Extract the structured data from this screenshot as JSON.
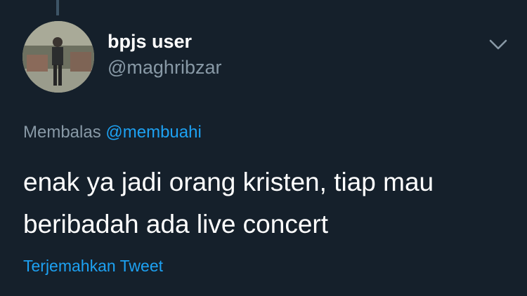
{
  "tweet": {
    "author": {
      "display_name": "bpjs user",
      "handle": "@maghribzar"
    },
    "reply_to": {
      "prefix": "Membalas",
      "mention": "@membuahi"
    },
    "text": "enak ya jadi orang kristen, tiap mau beribadah ada live concert",
    "translate_label": "Terjemahkan Tweet",
    "menu_icon": "chevron-down-icon"
  },
  "colors": {
    "background": "#15202b",
    "primary_text": "#ffffff",
    "secondary_text": "#8899a6",
    "accent": "#1da1f2",
    "thread_line": "#3d5466"
  }
}
